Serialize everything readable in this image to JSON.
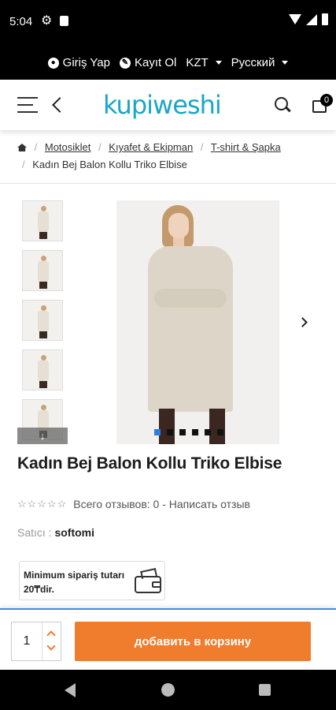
{
  "status_bar": {
    "time": "5:04"
  },
  "top_links": {
    "login": "Giriş Yap",
    "register": "Kayıt Ol",
    "currency": "KZT",
    "language": "Русский"
  },
  "header": {
    "logo_text": "kupiweshi",
    "cart_count": "0",
    "brand_color": "#1aa6c9"
  },
  "breadcrumb": {
    "items": [
      "Motosiklet",
      "Kıyafet & Ekipman",
      "T-shirt & Şapka"
    ],
    "current": "Kadın Bej Balon Kollu Triko Elbise"
  },
  "gallery": {
    "thumb_count": 5,
    "dot_count": 6,
    "active_dot": 0
  },
  "product": {
    "title": "Kadın Bej Balon Kollu Triko Elbise",
    "stars": "☆☆☆☆☆",
    "reviews_text": "Всего отзывов: 0",
    "write_review": "Написать отзыв",
    "seller_label": "Satıcı :",
    "seller_name": "softomi",
    "min_order_text": "Minimum sipariş tutarı 20₸dir."
  },
  "cart_bar": {
    "quantity": "1",
    "add_to_cart": "добавить в корзину",
    "accent_color": "#ef7d2d"
  }
}
